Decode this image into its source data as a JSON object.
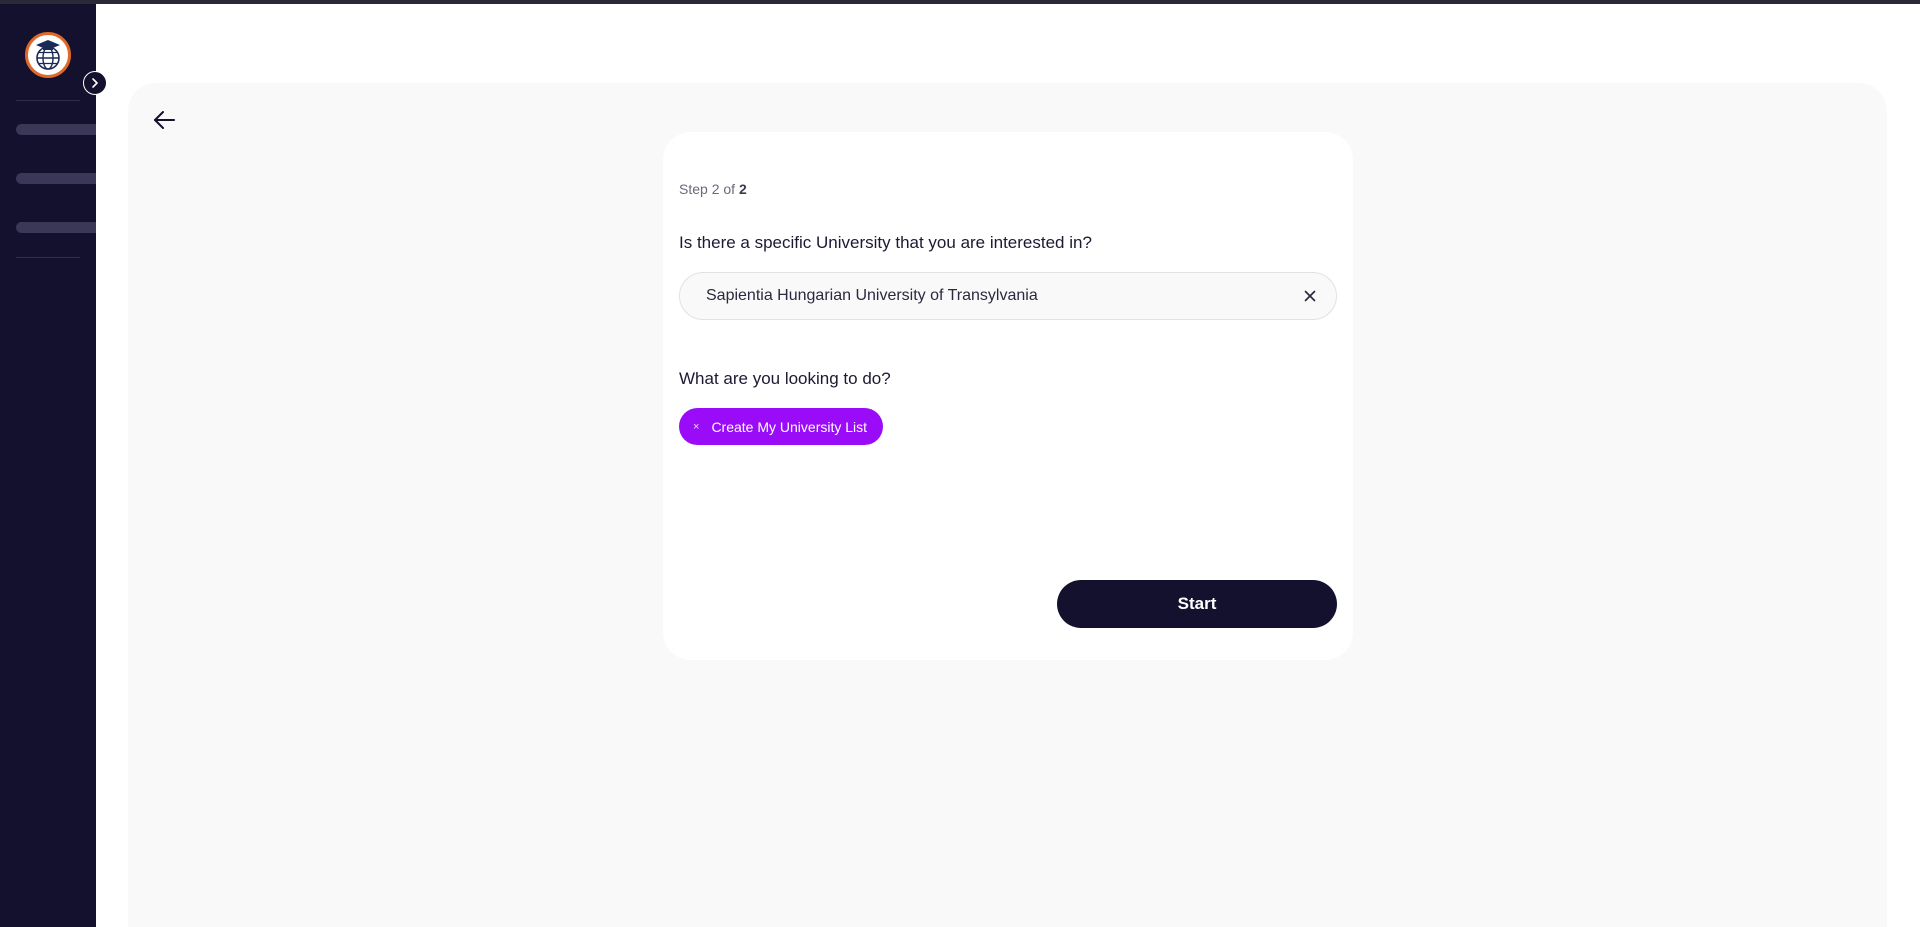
{
  "app": {
    "logo_icon": "globe-graduation-cap-icon",
    "sidebar_toggle_icon": "chevron-right-icon",
    "back_icon": "arrow-left-icon"
  },
  "wizard": {
    "step_prefix": "Step 2 of ",
    "step_total": "2",
    "university_question": "Is there a specific University that you are interested in?",
    "university_value": "Sapientia Hungarian University of Transylvania",
    "clear_icon": "close-icon",
    "goal_question": "What are you looking to do?",
    "selected_goal": {
      "remove_glyph": "×",
      "label": "Create My University List"
    },
    "start_label": "Start"
  },
  "colors": {
    "sidebar": "#13112e",
    "accent_purple": "#9a0cf7",
    "logo_ring": "#e0692a",
    "panel_bg": "#f9f9f9"
  }
}
